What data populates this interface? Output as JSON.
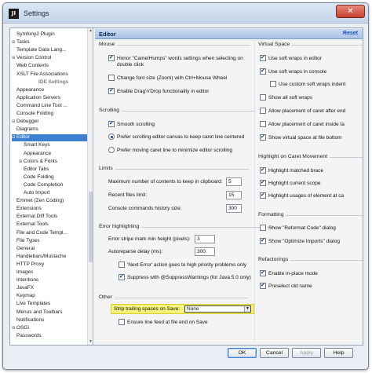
{
  "window": {
    "title": "Settings",
    "app_icon_text": "JI",
    "close_symbol": "✕"
  },
  "sidebar": {
    "items": [
      {
        "label": "Symfony2 Plugin",
        "indent": 0,
        "expander": ""
      },
      {
        "label": "Tasks",
        "indent": 0,
        "expander": "⊞"
      },
      {
        "label": "Template Data Lang...",
        "indent": 0,
        "expander": ""
      },
      {
        "label": "Version Control",
        "indent": 0,
        "expander": "⊞"
      },
      {
        "label": "Web Contexts",
        "indent": 0,
        "expander": ""
      },
      {
        "label": "XSLT File Associations",
        "indent": 0,
        "expander": ""
      },
      {
        "label": "IDE Settings",
        "indent": 0,
        "expander": "",
        "header": true
      },
      {
        "label": "Appearance",
        "indent": 0,
        "expander": ""
      },
      {
        "label": "Application Servers",
        "indent": 0,
        "expander": ""
      },
      {
        "label": "Command Line Tool ...",
        "indent": 0,
        "expander": ""
      },
      {
        "label": "Console Folding",
        "indent": 0,
        "expander": ""
      },
      {
        "label": "Debugger",
        "indent": 0,
        "expander": "⊞"
      },
      {
        "label": "Diagrams",
        "indent": 0,
        "expander": ""
      },
      {
        "label": "Editor",
        "indent": 0,
        "expander": "⊟",
        "selected": true
      },
      {
        "label": "Smart Keys",
        "indent": 1,
        "expander": ""
      },
      {
        "label": "Appearance",
        "indent": 1,
        "expander": ""
      },
      {
        "label": "Colors & Fonts",
        "indent": 1,
        "expander": "⊞"
      },
      {
        "label": "Editor Tabs",
        "indent": 1,
        "expander": ""
      },
      {
        "label": "Code Folding",
        "indent": 1,
        "expander": ""
      },
      {
        "label": "Code Completion",
        "indent": 1,
        "expander": ""
      },
      {
        "label": "Auto Import",
        "indent": 1,
        "expander": ""
      },
      {
        "label": "Emmet (Zen Coding)",
        "indent": 0,
        "expander": ""
      },
      {
        "label": "Extensions",
        "indent": 0,
        "expander": ""
      },
      {
        "label": "External Diff Tools",
        "indent": 0,
        "expander": ""
      },
      {
        "label": "External Tools",
        "indent": 0,
        "expander": ""
      },
      {
        "label": "File and Code Templ...",
        "indent": 0,
        "expander": ""
      },
      {
        "label": "File Types",
        "indent": 0,
        "expander": ""
      },
      {
        "label": "General",
        "indent": 0,
        "expander": ""
      },
      {
        "label": "Handlebars/Mustache",
        "indent": 0,
        "expander": ""
      },
      {
        "label": "HTTP Proxy",
        "indent": 0,
        "expander": ""
      },
      {
        "label": "Images",
        "indent": 0,
        "expander": ""
      },
      {
        "label": "Intentions",
        "indent": 0,
        "expander": ""
      },
      {
        "label": "JavaFX",
        "indent": 0,
        "expander": ""
      },
      {
        "label": "Keymap",
        "indent": 0,
        "expander": ""
      },
      {
        "label": "Live Templates",
        "indent": 0,
        "expander": ""
      },
      {
        "label": "Menus and Toolbars",
        "indent": 0,
        "expander": ""
      },
      {
        "label": "Notifications",
        "indent": 0,
        "expander": ""
      },
      {
        "label": "OSGi",
        "indent": 0,
        "expander": "⊞"
      },
      {
        "label": "Passwords",
        "indent": 0,
        "expander": ""
      }
    ]
  },
  "main": {
    "title": "Editor",
    "reset": "Reset",
    "mouse": {
      "title": "Mouse",
      "camel_1": "Honor \"CamelHumps\" words settings when selecting on",
      "camel_2": "double click",
      "font_size": "Change font size (Zoom) with Ctrl+Mouse Wheel",
      "drag_drop": "Enable Drag'n'Drop functionality in editor"
    },
    "scrolling": {
      "title": "Scrolling",
      "smooth": "Smooth scrolling",
      "prefer_scroll": "Prefer scrolling editor canvas to keep caret line centered",
      "prefer_move": "Prefer moving caret line to minimize editor scrolling"
    },
    "limits": {
      "title": "Limits",
      "clipboard_label": "Maximum number of contents to keep in clipboard:",
      "clipboard_value": "5",
      "recent_label": "Recent files limit:",
      "recent_value": "15",
      "console_label": "Console commands history size:",
      "console_value": "300"
    },
    "error_highlighting": {
      "title": "Error highlighting",
      "stripe_label": "Error stripe mark min height (pixels):",
      "stripe_value": "3",
      "autoreparse_label": "Autoreparse delay (ms):",
      "autoreparse_value": "300",
      "next_error": "'Next Error' action goes to high priority problems only",
      "suppress": "Suppress with @SuppressWarnings (for Java 5.0 only)"
    },
    "other": {
      "title": "Other",
      "strip_label": "Strip trailing spaces on Save:",
      "strip_value": "None",
      "ensure_feed": "Ensure line feed at file end on Save"
    },
    "virtual_space": {
      "title": "Virtual Space",
      "soft_wraps_editor": "Use soft wraps in editor",
      "soft_wraps_console": "Use soft wraps in console",
      "custom_indent": "Use custom soft wraps indent",
      "show_all": "Show all soft wraps",
      "allow_after": "Allow placement of caret after end",
      "allow_inside": "Allow placement of caret inside ta",
      "show_virtual": "Show virtual space at file bottom"
    },
    "caret_movement": {
      "title": "Highlight on Caret Movement",
      "matched_brace": "Highlight matched brace",
      "current_scope": "Highlight current scope",
      "usages": "Highlight usages of element at ca"
    },
    "formatting": {
      "title": "Formatting",
      "reformat": "Show \"Reformat Code\" dialog",
      "optimize": "Show \"Optimize Imports\" dialog"
    },
    "refactorings": {
      "title": "Refactorings",
      "inplace": "Enable in-place mode",
      "preselect": "Preselect old name"
    }
  },
  "buttons": {
    "ok": "OK",
    "cancel": "Cancel",
    "apply": "Apply",
    "help": "Help"
  },
  "colors": {
    "accent": "#3d7fd1",
    "highlight": "#f6f37c"
  }
}
